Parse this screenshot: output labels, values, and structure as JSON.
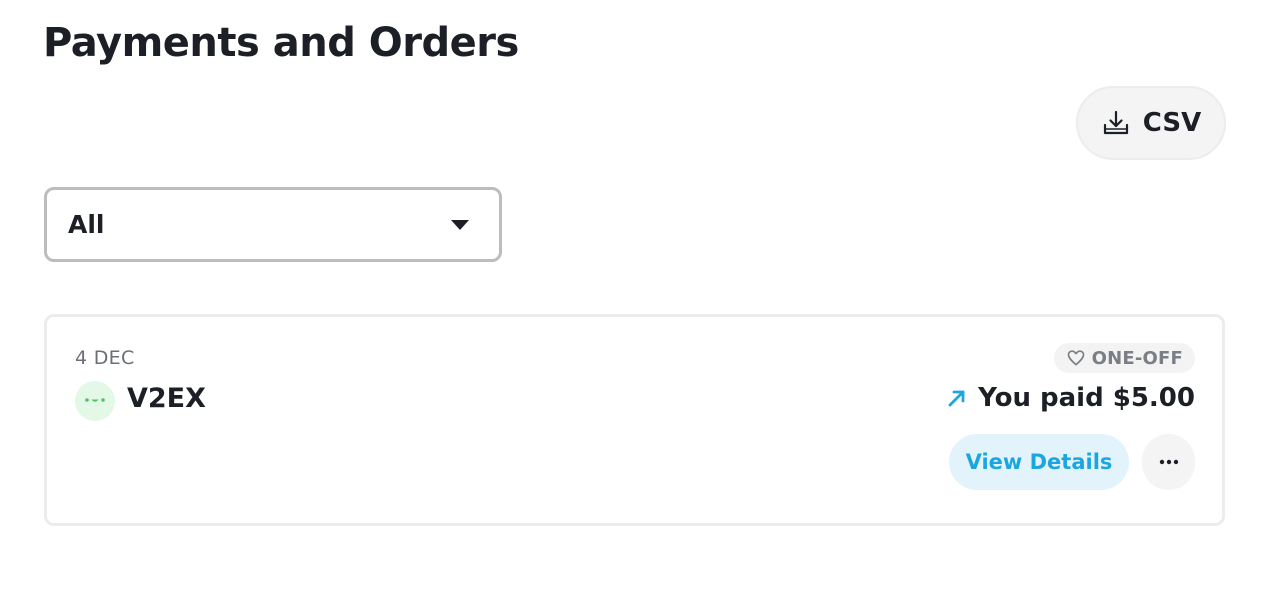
{
  "page": {
    "title": "Payments and Orders"
  },
  "toolbar": {
    "csv_label": "CSV",
    "csv_icon": "download-icon"
  },
  "filter": {
    "selected": "All",
    "icon": "caret-down-icon"
  },
  "orders": [
    {
      "date": "4 DEC",
      "merchant": "V2EX",
      "avatar_icon": "smiley-face-icon",
      "type_label": "ONE-OFF",
      "type_icon": "heart-icon",
      "amount_label": "You paid $5.00",
      "amount_icon": "arrow-up-right-icon",
      "view_details_label": "View Details",
      "more_icon": "more-horizontal-icon"
    }
  ],
  "colors": {
    "accent": "#1ba6e0",
    "accent_bg": "#e2f3fc",
    "avatar_bg": "#e3f8e7",
    "avatar_fg": "#4cc46a",
    "text_primary": "#1c2026",
    "text_muted": "#6b6f76"
  }
}
